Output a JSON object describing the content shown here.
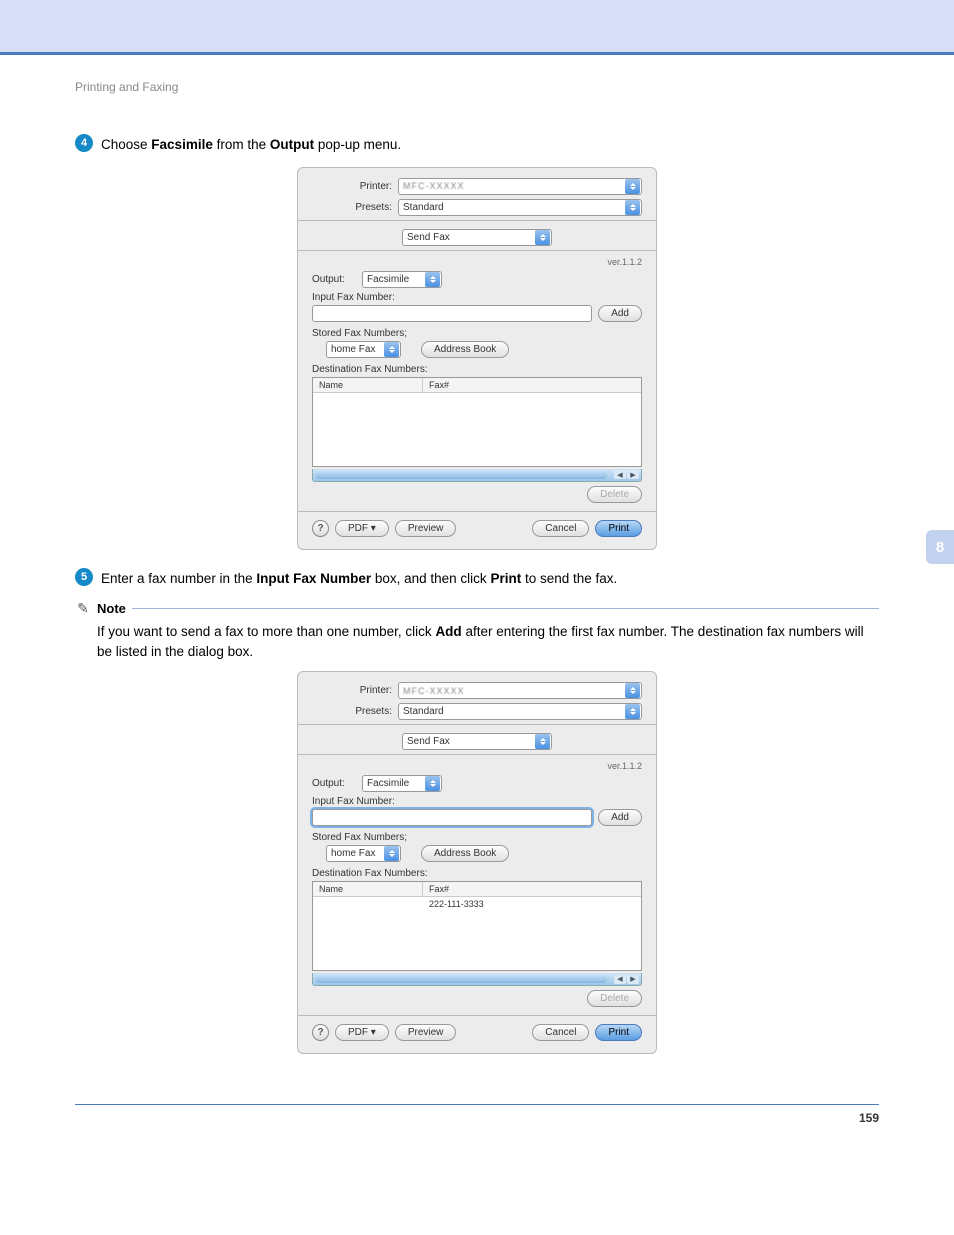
{
  "header": {
    "section": "Printing and Faxing"
  },
  "steps": {
    "s4": {
      "num": "4",
      "pre": "Choose ",
      "b1": "Facsimile",
      "mid": " from the ",
      "b2": "Output",
      "post": " pop-up menu."
    },
    "s5": {
      "num": "5",
      "pre": "Enter a fax number in the ",
      "b1": "Input Fax Number",
      "mid": " box, and then click ",
      "b2": "Print",
      "post": " to send the fax."
    }
  },
  "note": {
    "label": "Note",
    "pre": "If you want to send a fax to more than one number, click ",
    "b1": "Add",
    "post": " after entering the first fax number. The destination fax numbers will be listed in the dialog box."
  },
  "dialog": {
    "labels": {
      "printer": "Printer:",
      "presets": "Presets:",
      "output": "Output:",
      "input_fax": "Input Fax Number:",
      "stored": "Stored Fax Numbers;",
      "dest": "Destination Fax Numbers:",
      "col_name": "Name",
      "col_fax": "Fax#"
    },
    "values": {
      "printer": "MFC-XXXXX",
      "presets": "Standard",
      "section": "Send Fax",
      "output": "Facsimile",
      "stored_type": "home Fax",
      "version": "ver.1.1.2"
    },
    "buttons": {
      "add": "Add",
      "address_book": "Address Book",
      "delete": "Delete",
      "pdf": "PDF ▾",
      "preview": "Preview",
      "cancel": "Cancel",
      "print": "Print",
      "help": "?"
    },
    "screenshot2": {
      "fax_entry": "222-111-3333"
    }
  },
  "chrome": {
    "chapter_tab": "8",
    "page_number": "159"
  }
}
